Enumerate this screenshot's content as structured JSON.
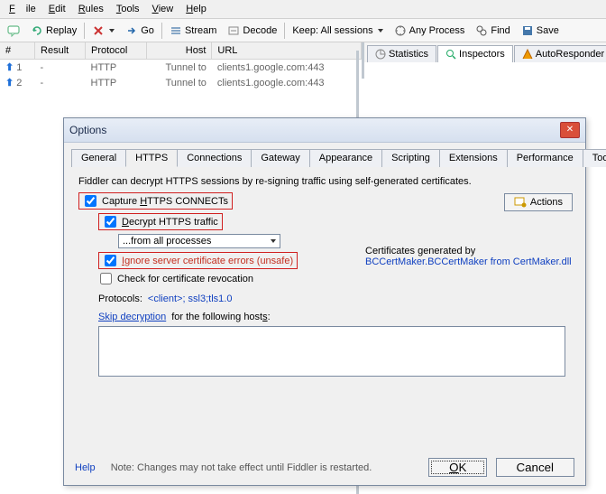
{
  "menu": {
    "file": "File",
    "edit": "Edit",
    "rules": "Rules",
    "tools": "Tools",
    "view": "View",
    "help": "Help"
  },
  "toolbar": {
    "replay": "Replay",
    "go": "Go",
    "stream": "Stream",
    "decode": "Decode",
    "keep": "Keep: All sessions",
    "process": "Any Process",
    "find": "Find",
    "save": "Save"
  },
  "right_tabs": {
    "statistics": "Statistics",
    "inspectors": "Inspectors",
    "autoresponder": "AutoResponder"
  },
  "sessions": {
    "headers": {
      "num": "#",
      "result": "Result",
      "protocol": "Protocol",
      "host": "Host",
      "url": "URL"
    },
    "rows": [
      {
        "num": "1",
        "result": "-",
        "protocol": "HTTP",
        "host": "Tunnel to",
        "url": "clients1.google.com:443"
      },
      {
        "num": "2",
        "result": "-",
        "protocol": "HTTP",
        "host": "Tunnel to",
        "url": "clients1.google.com:443"
      }
    ]
  },
  "dialog": {
    "title": "Options",
    "tabs": [
      "General",
      "HTTPS",
      "Connections",
      "Gateway",
      "Appearance",
      "Scripting",
      "Extensions",
      "Performance",
      "Tools"
    ],
    "active_tab": "HTTPS",
    "desc": "Fiddler can decrypt HTTPS sessions by re-signing traffic using self-generated certificates.",
    "capture_label": "Capture HTTPS CONNECTs",
    "decrypt_label": "Decrypt HTTPS traffic",
    "processes_value": "...from all processes",
    "ignore_label": "Ignore server certificate errors (unsafe)",
    "revoke_label": "Check for certificate revocation",
    "protocols_label": "Protocols: ",
    "protocols_value": "<client>; ssl3;tls1.0",
    "skip_label": "Skip decryption",
    "skip_suffix": " for the following hosts:",
    "cert_line1": "Certificates generated by",
    "cert_line2": "BCCertMaker.BCCertMaker from CertMaker.dll",
    "actions": "Actions",
    "help": "Help",
    "note": "Note: Changes may not take effect until Fiddler is restarted.",
    "ok": "OK",
    "cancel": "Cancel"
  }
}
